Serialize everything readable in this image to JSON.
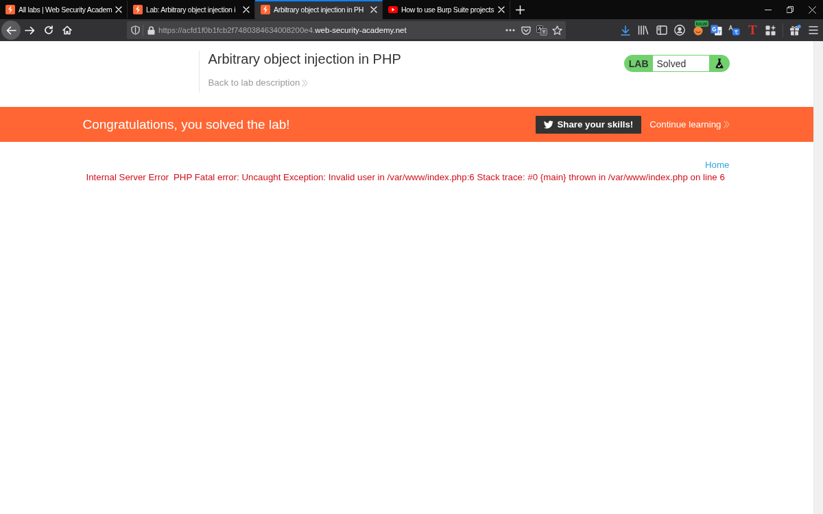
{
  "browser": {
    "tabs": [
      {
        "title": "All labs | Web Security Academ",
        "kind": "bolt",
        "selected": false
      },
      {
        "title": "Lab: Arbitrary object injection i",
        "kind": "bolt",
        "selected": false
      },
      {
        "title": "Arbitrary object injection in PH",
        "kind": "bolt",
        "selected": true
      },
      {
        "title": "How to use Burp Suite projects",
        "kind": "play",
        "selected": false
      }
    ],
    "address_bar": {
      "url_prefix": "https://acfd1f0b1fcb2f7480384634008200e4.",
      "url_domain": "web-security-academy.net"
    },
    "toolbar": {
      "extension_badge": "local",
      "extension_letter": "T"
    }
  },
  "lab_header": {
    "title": "Arbitrary object injection in PHP",
    "back_link": "Back to lab description",
    "status": {
      "label": "LAB",
      "value": "Solved",
      "solved": true
    }
  },
  "banner": {
    "message": "Congratulations, you solved the lab!",
    "share_button": "Share your skills!",
    "continue_link": "Continue learning"
  },
  "page": {
    "home_link": "Home",
    "error": {
      "title": "Internal Server Error",
      "message": "PHP Fatal error: Uncaught Exception: Invalid user in /var/www/index.php:6 Stack trace: #0 {main} thrown in /var/www/index.php on line 6"
    }
  }
}
